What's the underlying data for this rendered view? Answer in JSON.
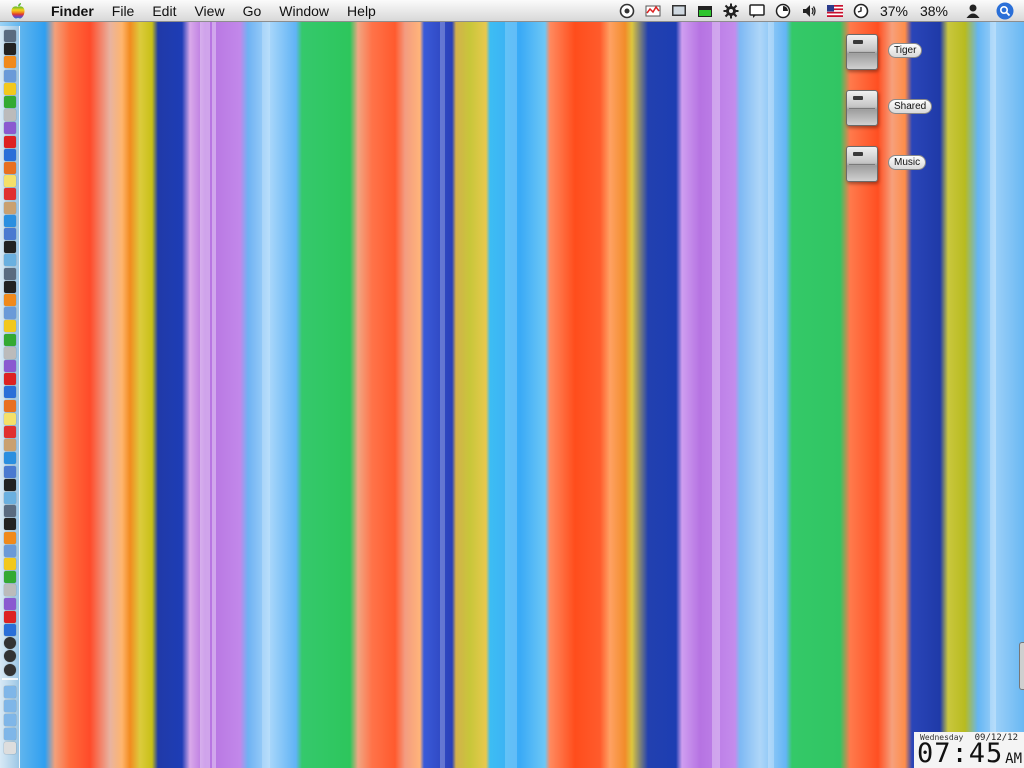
{
  "menubar": {
    "app_name": "Finder",
    "menus": [
      "File",
      "Edit",
      "View",
      "Go",
      "Window",
      "Help"
    ],
    "status_icons": [
      "sync-icon",
      "network-graph-icon",
      "display-icon",
      "activity-monitor-icon",
      "gear-icon",
      "chat-icon",
      "timer-icon",
      "volume-icon",
      "us-flag-icon",
      "clock-icon"
    ],
    "battery_1": "37%",
    "battery_2": "38%",
    "user_icon": "user-icon",
    "spotlight_icon": "spotlight-search-icon"
  },
  "desktop": {
    "drives": [
      {
        "label": "Tiger"
      },
      {
        "label": "Shared"
      },
      {
        "label": "Music"
      }
    ]
  },
  "clock": {
    "day": "Wednesday",
    "date": "09/12/12",
    "time": "07:45",
    "ampm": "AM"
  },
  "colors": {
    "spotlight": "#2a6fd8",
    "menubar_top": "#fbfbfb",
    "menubar_bottom": "#d8d8d8"
  }
}
